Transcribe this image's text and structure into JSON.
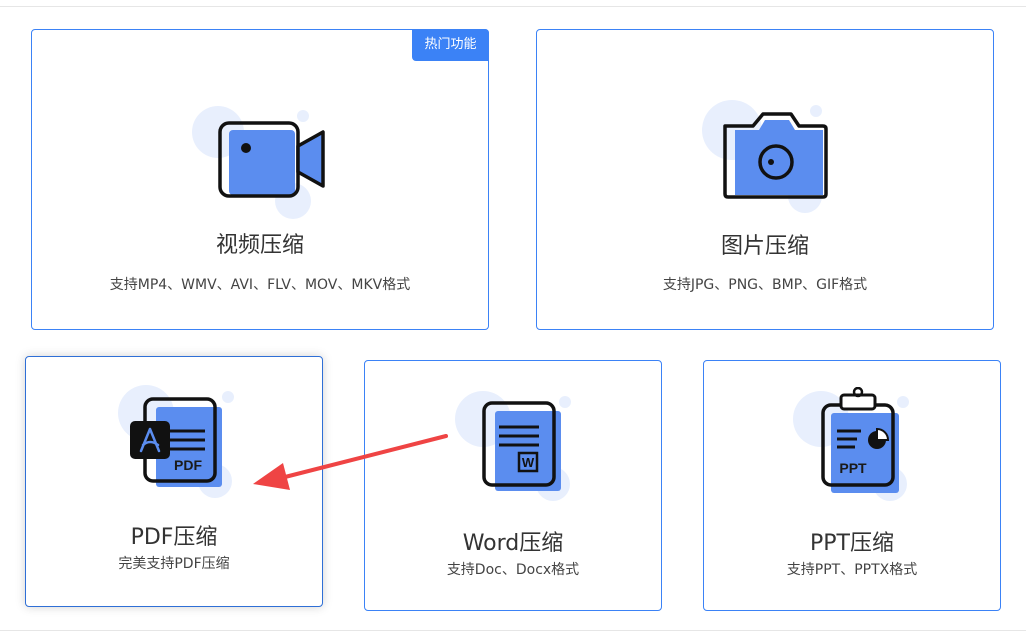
{
  "hot_badge": "热门功能",
  "colors": {
    "accent": "#3b82f6",
    "icon_fill": "#5b8def",
    "bubble": "#e8effd",
    "annotation_arrow": "#ef4444"
  },
  "cards": [
    {
      "id": "video",
      "icon": "video-camera-icon",
      "title": "视频压缩",
      "desc": "支持MP4、WMV、AVI、FLV、MOV、MKV格式"
    },
    {
      "id": "image",
      "icon": "camera-icon",
      "title": "图片压缩",
      "desc": "支持JPG、PNG、BMP、GIF格式"
    },
    {
      "id": "pdf",
      "icon": "pdf-file-icon",
      "title": "PDF压缩",
      "desc": "完美支持PDF压缩",
      "icon_text": "PDF"
    },
    {
      "id": "word",
      "icon": "word-file-icon",
      "title": "Word压缩",
      "desc": "支持Doc、Docx格式",
      "icon_text": "W"
    },
    {
      "id": "ppt",
      "icon": "ppt-file-icon",
      "title": "PPT压缩",
      "desc": "支持PPT、PPTX格式",
      "icon_text": "PPT"
    }
  ]
}
